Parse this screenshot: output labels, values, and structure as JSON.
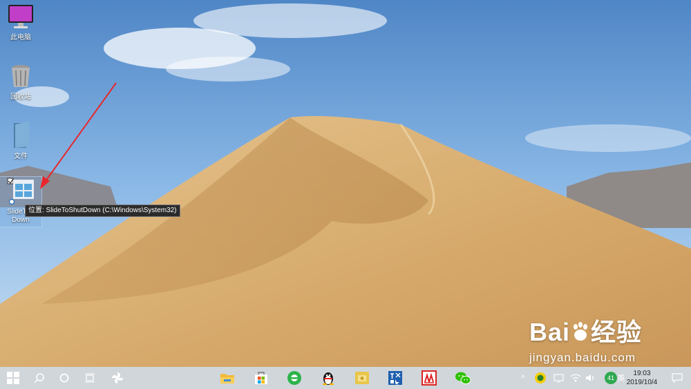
{
  "desktop": {
    "icons": [
      {
        "label": "此电脑",
        "icon": "computer-monitor-icon"
      },
      {
        "label": "回收站",
        "icon": "recycle-bin-icon"
      },
      {
        "label": "文件",
        "icon": "folder-icon"
      },
      {
        "label_line1": "SlideToS",
        "label_line2": "Down",
        "icon": "slide-to-shutdown-shortcut-icon"
      }
    ],
    "tooltip": "位置: SlideToShutDown (C:\\Windows\\System32)"
  },
  "annotation": {
    "color": "#e8262b",
    "type": "red-arrow"
  },
  "watermark": {
    "brand": "Bai",
    "brand_cn": "经验",
    "url": "jingyan.baidu.com"
  },
  "taskbar": {
    "start_icon": "windows-start-icon",
    "search_icon": "search-icon",
    "cortana_icon": "cortana-circle-icon",
    "task_view_icon": "task-view-icon",
    "pinned": [
      "pinwheel-app-icon",
      "file-explorer-icon",
      "microsoft-store-icon",
      "ie-browser-icon",
      "qq-penguin-icon",
      "folder-app-icon",
      "toolbox-app-icon",
      "red-app-icon",
      "wechat-icon"
    ],
    "tray": {
      "chevron": "^",
      "badge": "41",
      "lang": "英",
      "time": "19:03",
      "date": "2019/10/4"
    }
  }
}
